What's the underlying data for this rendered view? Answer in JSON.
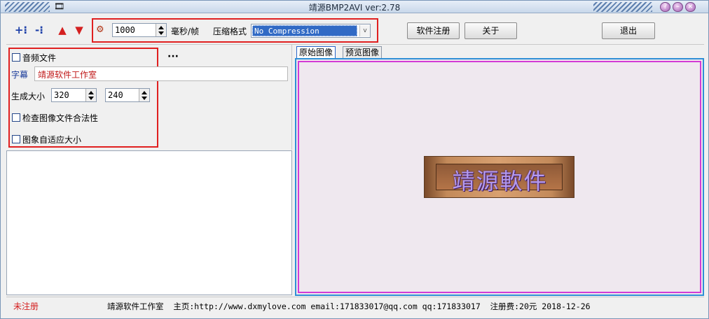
{
  "window": {
    "title": "靖源BMP2AVI ver:2.78"
  },
  "toolbar": {
    "frame_interval": "1000",
    "frame_unit": "毫秒/帧",
    "compress_label": "压缩格式",
    "compress_value": "No Compression",
    "register_label": "软件注册",
    "about_label": "关于",
    "exit_label": "退出"
  },
  "options": {
    "audio_label": "音频文件",
    "more_label": "···",
    "subtitle_label": "字幕",
    "subtitle_value": "靖源软件工作室",
    "size_label": "生成大小",
    "width_value": "320",
    "height_value": "240",
    "check_label": "检查图像文件合法性",
    "autofit_label": "图象自适应大小"
  },
  "tabs": [
    "原始图像",
    "预览图像"
  ],
  "preview": {
    "logo_text": "靖源軟件"
  },
  "status": {
    "register_state": "未注册",
    "info": "靖源软件工作室  主页:http://www.dxmylove.com email:171833017@qq.com qq:171833017  注册费:20元 2018-12-26"
  },
  "colors": {
    "accent_red": "#e02020",
    "preview_border": "#d23bd6",
    "link_blue": "#1a3c9a"
  }
}
